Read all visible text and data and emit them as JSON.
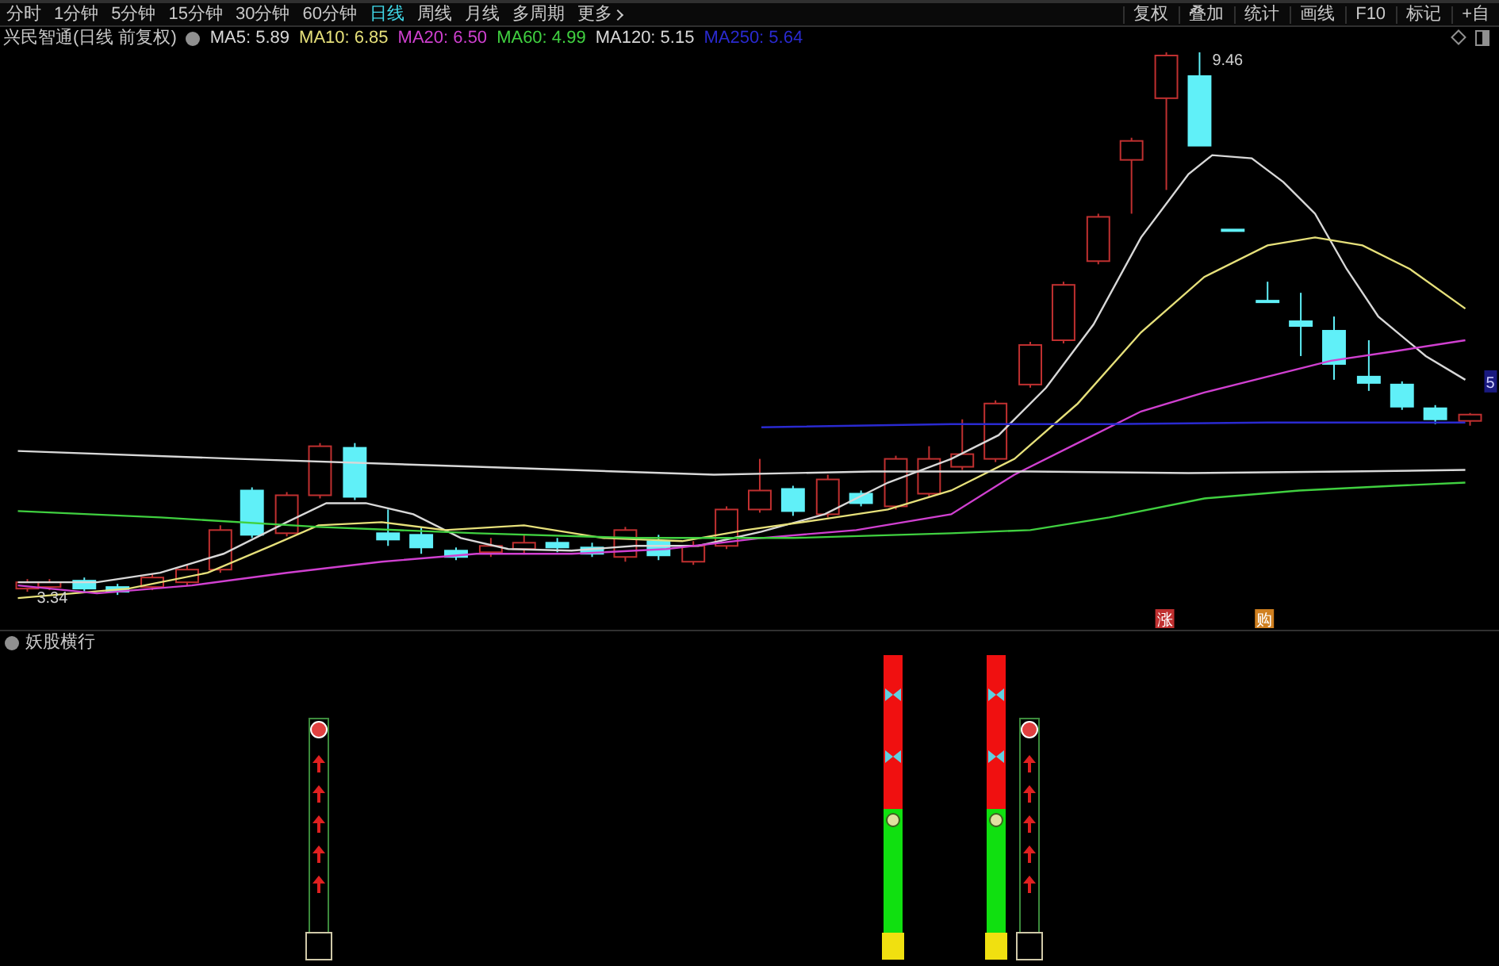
{
  "periods": [
    {
      "label": "分时",
      "selected": false
    },
    {
      "label": "1分钟",
      "selected": false
    },
    {
      "label": "5分钟",
      "selected": false
    },
    {
      "label": "15分钟",
      "selected": false
    },
    {
      "label": "30分钟",
      "selected": false
    },
    {
      "label": "60分钟",
      "selected": false
    },
    {
      "label": "日线",
      "selected": true
    },
    {
      "label": "周线",
      "selected": false
    },
    {
      "label": "月线",
      "selected": false
    },
    {
      "label": "多周期",
      "selected": false
    },
    {
      "label": "更多",
      "selected": false
    }
  ],
  "tools": [
    "复权",
    "叠加",
    "统计",
    "画线",
    "F10",
    "标记",
    "+自"
  ],
  "chart": {
    "title": "兴民智通(日线 前复权)",
    "legend": [
      {
        "label": "MA5: 5.89",
        "color": "#d8d8d8"
      },
      {
        "label": "MA10: 6.85",
        "color": "#e6e07a"
      },
      {
        "label": "MA20: 6.50",
        "color": "#d040d0"
      },
      {
        "label": "MA60: 4.99",
        "color": "#40d040"
      },
      {
        "label": "MA120: 5.15",
        "color": "#d8d8d8"
      },
      {
        "label": "MA250: 5.64",
        "color": "#2a2ad0"
      }
    ],
    "high_label": "9.46",
    "low_label": "3.34",
    "price_tag": "5",
    "markers": [
      {
        "label": "涨",
        "color": "#c03030"
      },
      {
        "label": "购",
        "color": "#d08020"
      }
    ]
  },
  "indicator": {
    "title": "妖股横行",
    "signals": [
      {
        "kind": "arrows"
      },
      {
        "kind": "bars"
      },
      {
        "kind": "bars"
      },
      {
        "kind": "arrows"
      }
    ]
  }
}
